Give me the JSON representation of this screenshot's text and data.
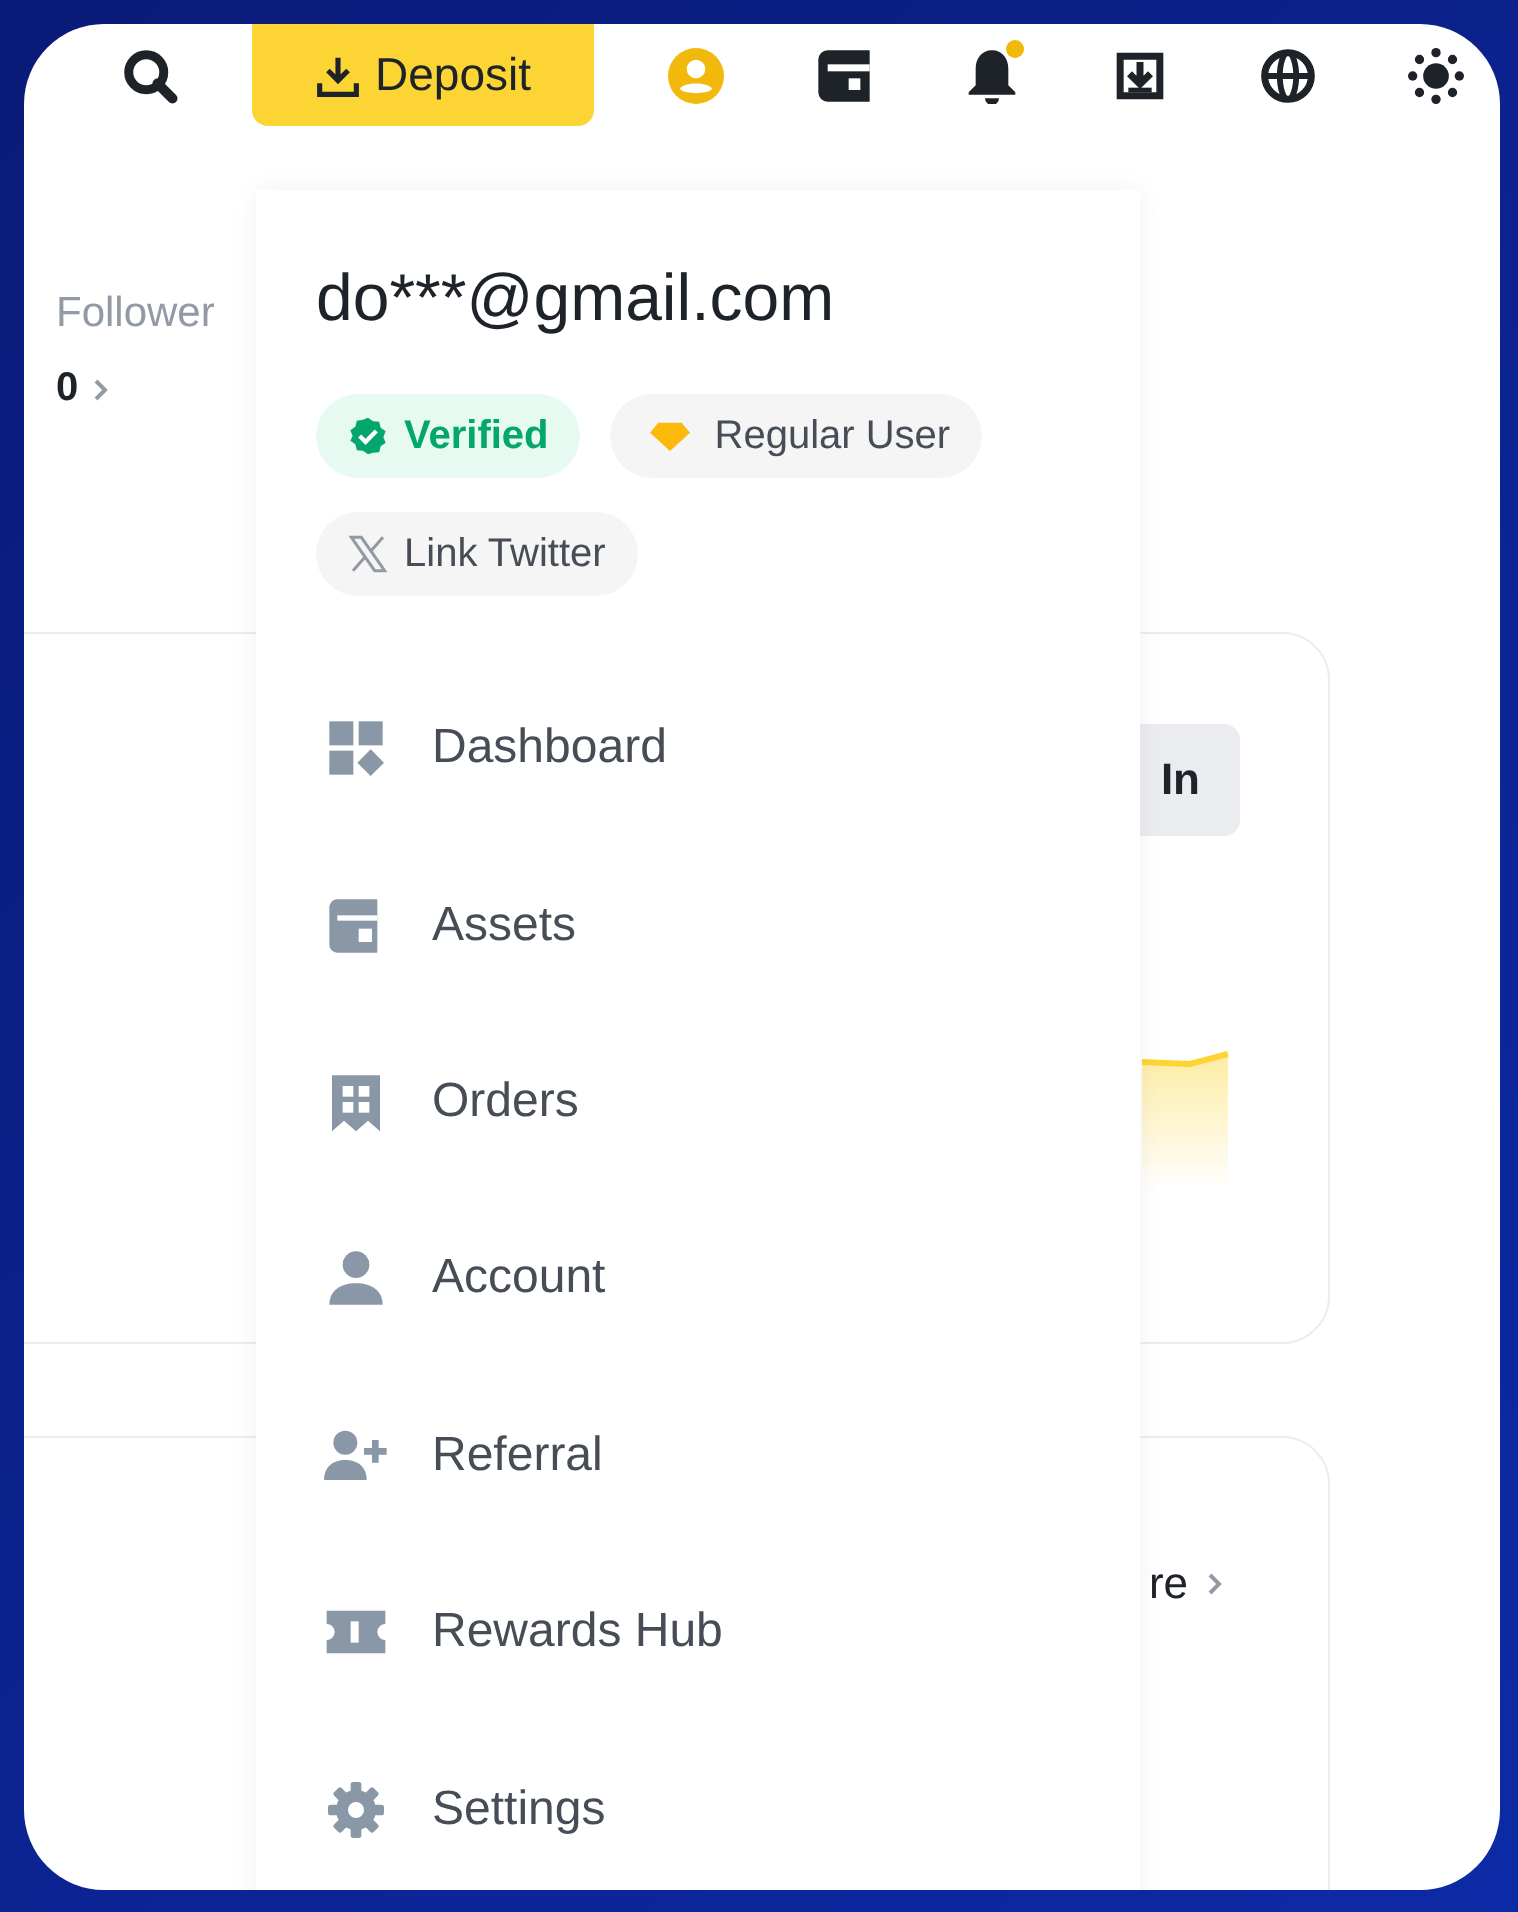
{
  "top_bar": {
    "deposit_button": "Deposit",
    "notifications": {
      "unread": true
    }
  },
  "profile_stats": {
    "followers_label": "Follower",
    "followers_count": "0"
  },
  "card": {
    "button": "In"
  },
  "card_2": {
    "link": "re"
  },
  "account_menu": {
    "email": "do***@gmail.com",
    "badges": [
      {
        "kind": "verified",
        "label": "Verified"
      },
      {
        "kind": "tier",
        "label": "Regular User"
      },
      {
        "kind": "twitter",
        "label": "Link Twitter"
      }
    ],
    "items": [
      {
        "kind": "dashboard",
        "label": "Dashboard"
      },
      {
        "kind": "assets",
        "label": "Assets"
      },
      {
        "kind": "orders",
        "label": "Orders"
      },
      {
        "kind": "account",
        "label": "Account"
      },
      {
        "kind": "referral",
        "label": "Referral"
      },
      {
        "kind": "rewards",
        "label": "Rewards Hub"
      },
      {
        "kind": "settings",
        "label": "Settings"
      }
    ]
  }
}
